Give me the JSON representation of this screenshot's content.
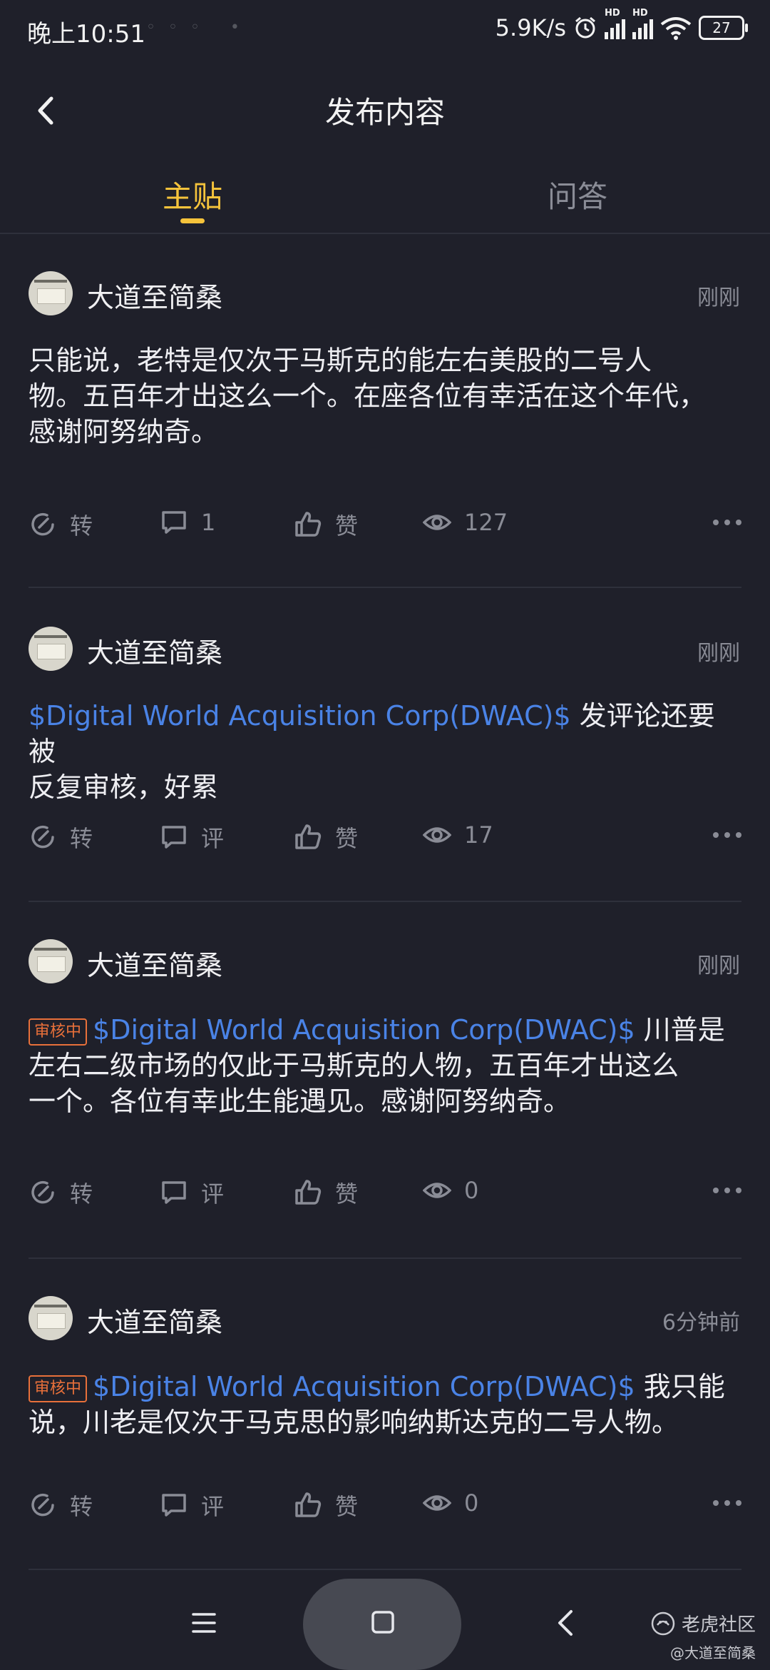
{
  "status_bar": {
    "time": "晚上10:51",
    "speed": "5.9K/s",
    "battery": "27"
  },
  "header": {
    "title": "发布内容"
  },
  "tabs": [
    {
      "label": "主贴"
    },
    {
      "label": "问答"
    }
  ],
  "posts": [
    {
      "author": "大道至简桑",
      "time": "刚刚",
      "status": "",
      "stock": "",
      "text_lines": [
        "只能说，老特是仅次于马斯克的能左右美股的二号人",
        "物。五百年才出这么一个。在座各位有幸活在这个年代，",
        "感谢阿努纳奇。"
      ],
      "repost": "转",
      "comment": "1",
      "like": "赞",
      "views": "127"
    },
    {
      "author": "大道至简桑",
      "time": "刚刚",
      "status": "",
      "stock": "$Digital World Acquisition Corp(DWAC)$",
      "after_stock": " 发评论还要被",
      "text_lines": [
        "反复审核，好累"
      ],
      "repost": "转",
      "comment": "评",
      "like": "赞",
      "views": "17"
    },
    {
      "author": "大道至简桑",
      "time": "刚刚",
      "status": "审核中",
      "stock": "$Digital World Acquisition Corp(DWAC)$",
      "after_stock": " 川普是",
      "text_lines": [
        "左右二级市场的仅此于马斯克的人物，五百年才出这么",
        "一个。各位有幸此生能遇见。感谢阿努纳奇。"
      ],
      "repost": "转",
      "comment": "评",
      "like": "赞",
      "views": "0"
    },
    {
      "author": "大道至简桑",
      "time": "6分钟前",
      "status": "审核中",
      "stock": "$Digital World Acquisition Corp(DWAC)$",
      "after_stock": " 我只能",
      "text_lines": [
        "说，川老是仅次于马克思的影响纳斯达克的二号人物。"
      ],
      "repost": "转",
      "comment": "评",
      "like": "赞",
      "views": "0"
    }
  ],
  "watermark": {
    "brand": "老虎社区",
    "handle": "@大道至简桑"
  }
}
